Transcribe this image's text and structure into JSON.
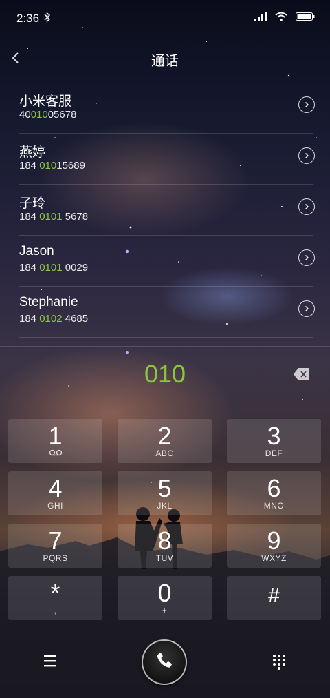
{
  "status": {
    "time": "2:36",
    "bluetooth_icon": "bluetooth-icon",
    "signal_icon": "signal-icon",
    "wifi_icon": "wifi-icon",
    "battery_icon": "battery-icon"
  },
  "header": {
    "title": "通话"
  },
  "results": [
    {
      "name": "小米客服",
      "pre": "40",
      "hl": "010",
      "post": "05678"
    },
    {
      "name": "燕婷",
      "pre": "184 ",
      "hl": "010",
      "post": "15689"
    },
    {
      "name": "子玲",
      "pre": "184 ",
      "hl": "0101",
      "post": " 5678"
    },
    {
      "name": "Jason",
      "pre": "184 ",
      "hl": "0101",
      "post": " 0029"
    },
    {
      "name": "Stephanie",
      "pre": "184 ",
      "hl": "0102",
      "post": " 4685"
    }
  ],
  "dial_input": "010",
  "keypad": [
    {
      "digit": "1",
      "letters": ""
    },
    {
      "digit": "2",
      "letters": "ABC"
    },
    {
      "digit": "3",
      "letters": "DEF"
    },
    {
      "digit": "4",
      "letters": "GHI"
    },
    {
      "digit": "5",
      "letters": "JKL"
    },
    {
      "digit": "6",
      "letters": "MNO"
    },
    {
      "digit": "7",
      "letters": "PQRS"
    },
    {
      "digit": "8",
      "letters": "TUV"
    },
    {
      "digit": "9",
      "letters": "WXYZ"
    },
    {
      "digit": "*",
      "letters": ","
    },
    {
      "digit": "0",
      "letters": "+"
    },
    {
      "digit": "#",
      "letters": ""
    }
  ],
  "colors": {
    "accent": "#8cc63f"
  }
}
